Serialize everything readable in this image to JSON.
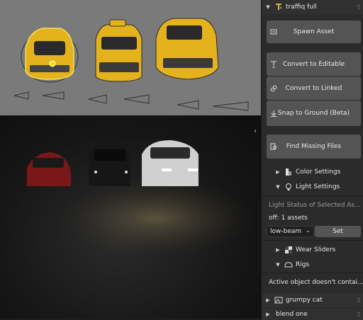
{
  "panel": {
    "header_label": "traffiq full",
    "spawn_asset": "Spawn Asset",
    "convert_editable": "Convert to Editable",
    "convert_linked": "Convert to Linked",
    "snap_ground": "Snap to Ground (Beta)",
    "find_missing": "Find Missing Files",
    "color_settings": "Color Settings",
    "light_settings": "Light Settings",
    "light_status": "Light Status of Selected As...",
    "off_assets": "off: 1 assets",
    "light_mode": "low-beam",
    "set_label": "Set",
    "wear_sliders": "Wear Sliders",
    "rigs": "Rigs",
    "active_object_msg": "Active object doesn't contai...",
    "grumpy_cat": "grumpy cat",
    "blend_one": "blend one"
  },
  "viewport": {
    "top_cars": [
      "yellow hatchback",
      "yellow taxi sedan",
      "yellow suv"
    ],
    "bottom_cars": [
      "red sedan",
      "black suv",
      "white suv"
    ]
  },
  "colors": {
    "accent_yellow": "#e3b21d",
    "panel_bg": "#2b2b2b",
    "button": "#545454"
  }
}
